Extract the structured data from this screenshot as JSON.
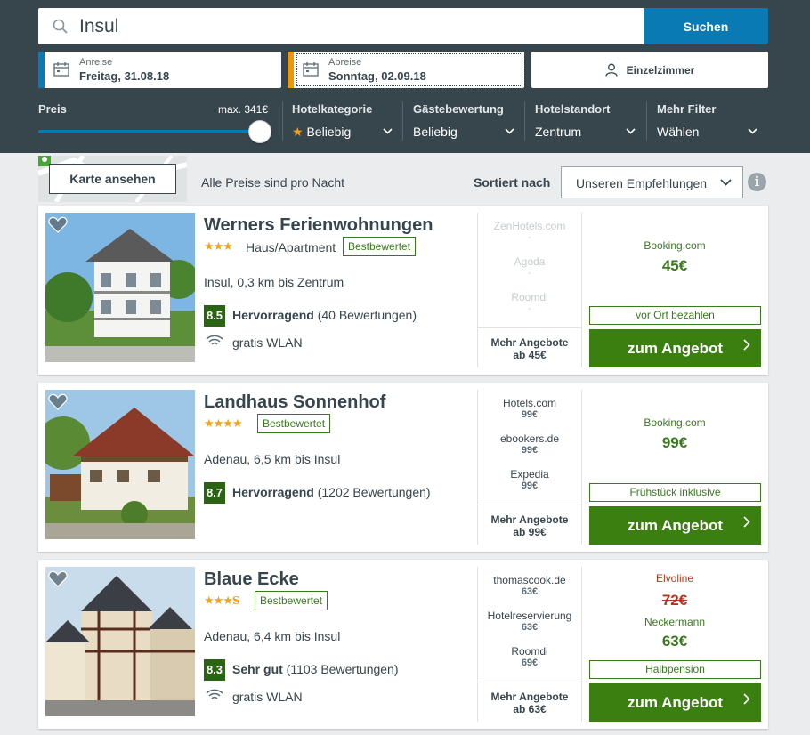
{
  "search": {
    "query": "Insul",
    "button": "Suchen"
  },
  "dates": {
    "arrival": {
      "label": "Anreise",
      "value": "Freitag, 31.08.18"
    },
    "departure": {
      "label": "Abreise",
      "value": "Sonntag, 02.09.18"
    }
  },
  "room": {
    "label": "Einzelzimmer"
  },
  "filters": {
    "price": {
      "label": "Preis",
      "max": "max. 341€",
      "slider_fraction": 1.0
    },
    "category": {
      "label": "Hotelkategorie",
      "value": "Beliebig"
    },
    "rating": {
      "label": "Gästebewertung",
      "value": "Beliebig"
    },
    "location": {
      "label": "Hotelstandort",
      "value": "Zentrum"
    },
    "more": {
      "label": "Mehr Filter",
      "value": "Wählen"
    }
  },
  "toolbar": {
    "map_button": "Karte ansehen",
    "price_note": "Alle Preise sind pro Nacht",
    "sort_label": "Sortiert nach",
    "sort_value": "Unseren Empfehlungen",
    "info_icon": "i"
  },
  "colors": {
    "header": "#37454d",
    "accent_blue": "#0a7ab5",
    "accent_orange": "#f39700",
    "cta_green": "#3a7f0f",
    "rating_green": "#2a6413"
  },
  "hotels": [
    {
      "name": "Werners Ferienwohnungen",
      "stars": "★★★",
      "type": "Haus/Apartment",
      "badge": "Bestbewertet",
      "location": "Insul, 0,3 km bis Zentrum",
      "rating": "8.5",
      "rating_label": "Hervorragend",
      "rating_count": "(40 Bewertungen)",
      "amenity": "gratis WLAN",
      "others": [
        {
          "name": "ZenHotels.com",
          "price": "-"
        },
        {
          "name": "Agoda",
          "price": "-"
        },
        {
          "name": "Roomdi",
          "price": "-"
        }
      ],
      "more_label": "Mehr Angebote",
      "more_price": "ab 45€",
      "provider": "Booking.com",
      "price": "45€",
      "tag": "vor Ort bezahlen",
      "cta": "zum Angebot"
    },
    {
      "name": "Landhaus Sonnenhof",
      "stars": "★★★★",
      "badge": "Bestbewertet",
      "location": "Adenau, 6,5 km bis Insul",
      "rating": "8.7",
      "rating_label": "Hervorragend",
      "rating_count": "(1202 Bewertungen)",
      "others": [
        {
          "name": "Hotels.com",
          "price": "99€"
        },
        {
          "name": "ebookers.de",
          "price": "99€"
        },
        {
          "name": "Expedia",
          "price": "99€"
        }
      ],
      "more_label": "Mehr Angebote",
      "more_price": "ab 99€",
      "provider": "Booking.com",
      "price": "99€",
      "tag": "Frühstück inklusive",
      "cta": "zum Angebot"
    },
    {
      "name": "Blaue Ecke",
      "stars": "★★★",
      "stars_suffix": "S",
      "badge": "Bestbewertet",
      "location": "Adenau, 6,4 km bis Insul",
      "rating": "8.3",
      "rating_label": "Sehr gut",
      "rating_count": "(1103 Bewertungen)",
      "amenity": "gratis WLAN",
      "others": [
        {
          "name": "thomascook.de",
          "price": "63€"
        },
        {
          "name": "Hotelreservierung",
          "price": "63€"
        },
        {
          "name": "Roomdi",
          "price": "69€"
        }
      ],
      "more_label": "Mehr Angebote",
      "more_price": "ab 63€",
      "old_provider": "Elvoline",
      "old_price": "72€",
      "provider": "Neckermann",
      "price": "63€",
      "tag": "Halbpension",
      "cta": "zum Angebot"
    }
  ]
}
